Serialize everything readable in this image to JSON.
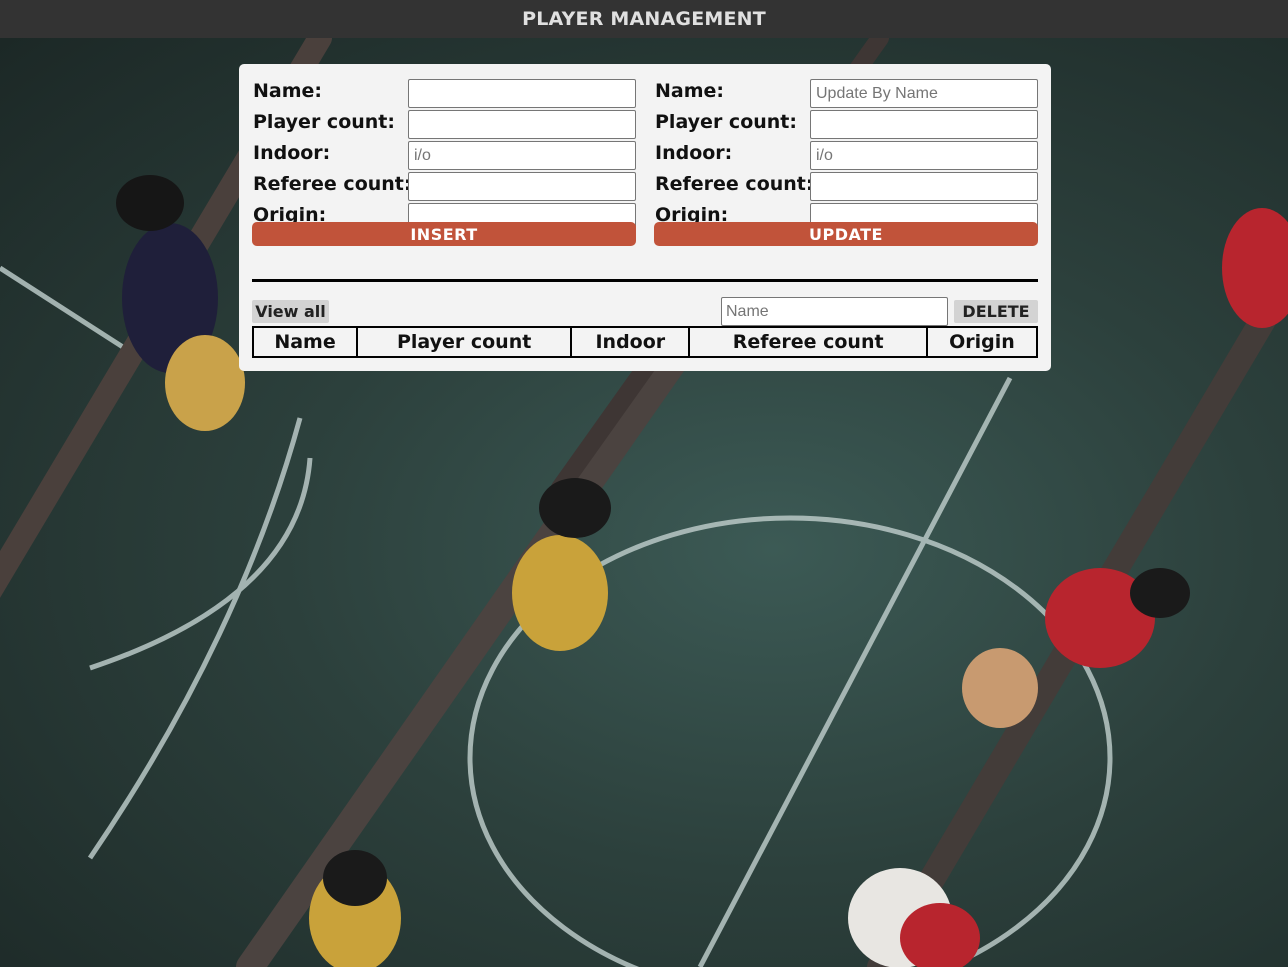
{
  "header": {
    "title": "PLAYER MANAGEMENT"
  },
  "insert_form": {
    "fields": [
      {
        "label": "Name:",
        "value": "",
        "placeholder": ""
      },
      {
        "label": "Player count:",
        "value": "",
        "placeholder": ""
      },
      {
        "label": "Indoor:",
        "value": "",
        "placeholder": "i/o"
      },
      {
        "label": "Referee count:",
        "value": "",
        "placeholder": ""
      },
      {
        "label": "Origin:",
        "value": "",
        "placeholder": ""
      }
    ],
    "button_label": "INSERT"
  },
  "update_form": {
    "fields": [
      {
        "label": "Name:",
        "value": "",
        "placeholder": "Update By Name"
      },
      {
        "label": "Player count:",
        "value": "",
        "placeholder": ""
      },
      {
        "label": "Indoor:",
        "value": "",
        "placeholder": "i/o"
      },
      {
        "label": "Referee count:",
        "value": "",
        "placeholder": ""
      },
      {
        "label": "Origin:",
        "value": "",
        "placeholder": ""
      }
    ],
    "button_label": "UPDATE"
  },
  "controls": {
    "view_all_label": "View all",
    "delete_placeholder": "Name",
    "delete_label": "DELETE"
  },
  "table": {
    "columns": [
      "Name",
      "Player count",
      "Indoor",
      "Referee count",
      "Origin"
    ],
    "rows": []
  },
  "colors": {
    "accent": "#c1533a",
    "header_bg": "#333333",
    "panel_bg": "#f3f3f3"
  }
}
